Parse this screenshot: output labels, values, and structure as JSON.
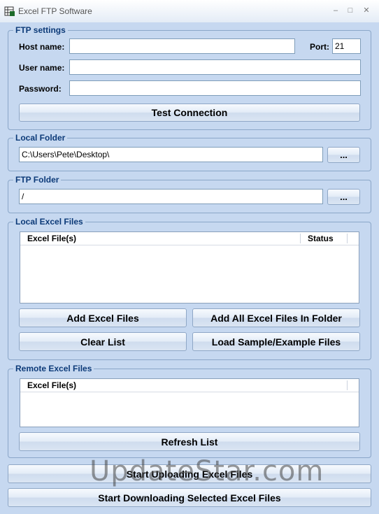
{
  "window": {
    "title": "Excel FTP Software",
    "minimize_glyph": "–",
    "maximize_glyph": "□",
    "close_glyph": "✕"
  },
  "ftp_settings": {
    "legend": "FTP settings",
    "host_label": "Host name:",
    "host_value": "",
    "port_label": "Port:",
    "port_value": "21",
    "user_label": "User name:",
    "user_value": "",
    "password_label": "Password:",
    "password_value": "",
    "test_button": "Test Connection"
  },
  "local_folder": {
    "legend": "Local Folder",
    "path": "C:\\Users\\Pete\\Desktop\\",
    "browse_button": "..."
  },
  "ftp_folder": {
    "legend": "FTP Folder",
    "path": "/",
    "browse_button": "..."
  },
  "local_files": {
    "legend": "Local Excel Files",
    "columns": [
      "Excel File(s)",
      "Status"
    ],
    "add_button": "Add Excel Files",
    "add_all_button": "Add All Excel Files In Folder",
    "clear_button": "Clear List",
    "load_sample_button": "Load Sample/Example Files"
  },
  "remote_files": {
    "legend": "Remote Excel Files",
    "columns": [
      "Excel File(s)"
    ],
    "refresh_button": "Refresh List"
  },
  "actions": {
    "upload_button": "Start Uploading Excel Files",
    "download_button": "Start Downloading Selected Excel Files"
  },
  "watermark": "UpdateStar.com"
}
